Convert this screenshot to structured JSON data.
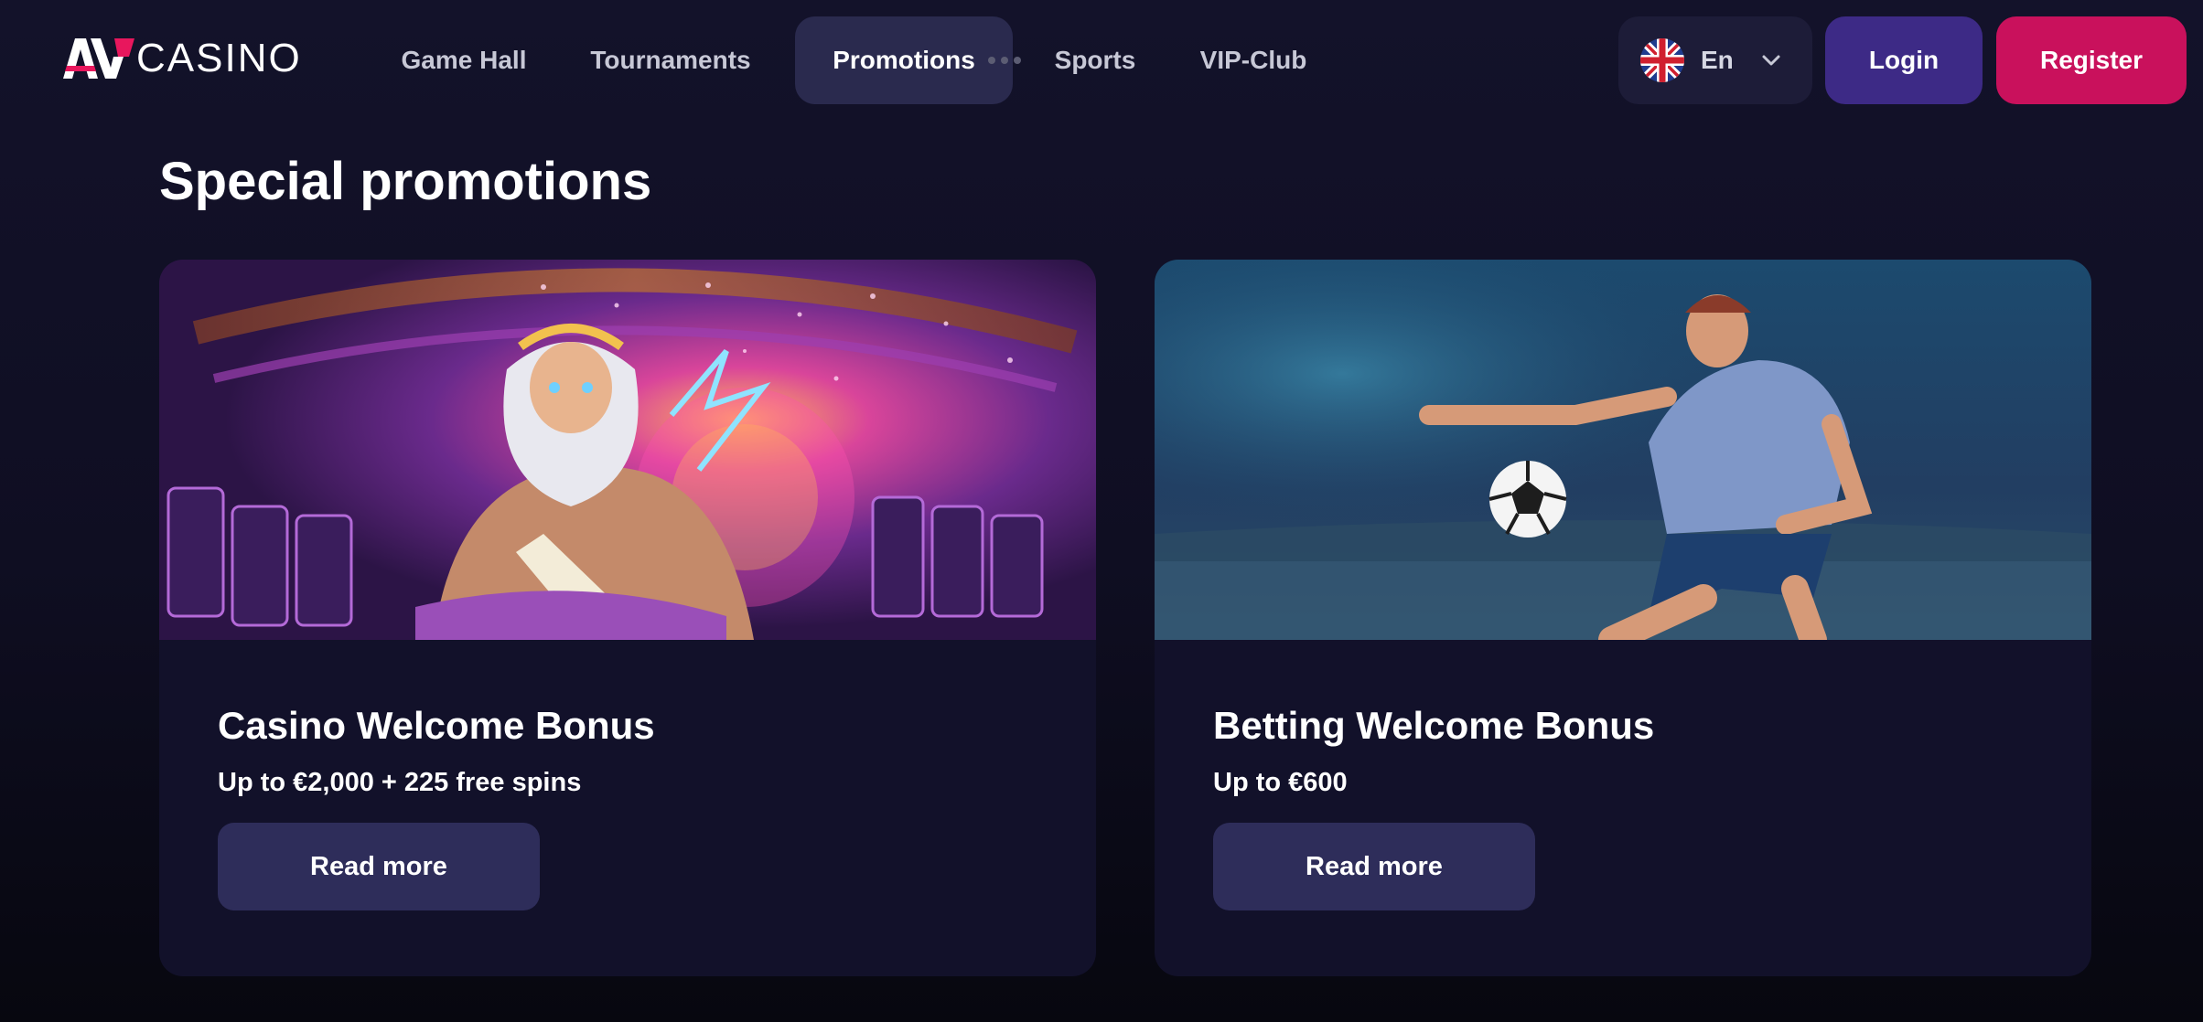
{
  "header": {
    "logo_text": "CASINO",
    "nav": [
      "Game Hall",
      "Tournaments",
      "Promotions",
      "Sports",
      "VIP-Club"
    ],
    "active_nav": "Promotions",
    "language": {
      "label": "En",
      "flag": "uk-flag-icon"
    },
    "login_label": "Login",
    "register_label": "Register"
  },
  "main": {
    "section_title": "Special promotions",
    "promotions": [
      {
        "title": "Casino Welcome Bonus",
        "subtitle": "Up to €2,000 + 225 free spins",
        "button": "Read more",
        "image": "zeus-casino-illustration"
      },
      {
        "title": "Betting Welcome Bonus",
        "subtitle": "Up to €600",
        "button": "Read more",
        "image": "football-player-illustration"
      }
    ]
  },
  "colors": {
    "background": "#13122a",
    "card": "#12112a",
    "nav_active": "#2a2a4e",
    "login": "#3d2a86",
    "register": "#c9115c",
    "card_button": "#2e2d5a",
    "logo_accent": "#e8175d"
  }
}
